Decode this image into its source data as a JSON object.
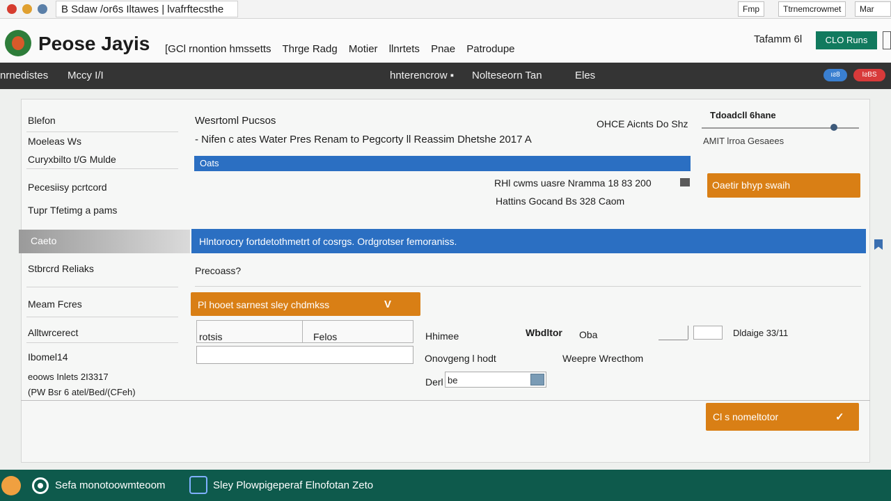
{
  "browser": {
    "tab_title": "B Sdaw /or6s Iltawes | lvafrftecsthe",
    "right_tab_1": "Fmp",
    "right_tab_2": "Ttrnemcrowmet",
    "right_tab_3": "Mar"
  },
  "header": {
    "logo_text": "Peose Jayis",
    "nav": [
      "[GCl rnontion hmssetts",
      "Thrge Radg",
      "Motier",
      "llnrtets",
      "Pnae",
      "Patrodupe"
    ],
    "user_text": "Tafamm 6l",
    "action_button": "CLO Runs"
  },
  "darknav": {
    "left_1": "nrnedistes",
    "left_2": "Mccy I/I",
    "center_1": "hnterencrow ▪",
    "center_2": "Nolteseorn Tan",
    "center_3": "Eles",
    "pill_blue": "ıƨ8",
    "pill_red": "IƨBS"
  },
  "sidebar": {
    "item_1": "Blefon",
    "item_2": "Moeleas Ws",
    "item_3": "Curyxbilto t/G Mulde",
    "item_4": "Pecesiisy pcrtcord",
    "item_5": "Tupr Tfetimg a pams",
    "section_header": "Caeto",
    "item_6": "Stbrcrd Reliaks",
    "item_7": "Meam Fcres",
    "item_8": "Alltwrcerect",
    "item_9": "Ibomel14",
    "item_10": "eoows Inlets 2I3317",
    "item_11": "(PW Bsr 6 atel/Bed/(CFeh)"
  },
  "main": {
    "title": "Wesrtoml Pucsos",
    "subtitle": "- Nifen c ates Water Pres Renam to Pegcorty ll Reassim Dhetshe 2017 A",
    "blue_bar_label": "Oats",
    "info_line_1": "RHl cwms uasre Nramma 18 83 200",
    "info_line_2": "Hattins Gocand Bs 328 Caom",
    "header_meta": "OHCE Aicnts Do Shz",
    "slider_label": "Tdoadcll 6hane",
    "slider_caption": "AMIT lrroa Gesaees",
    "orange_button_1": "Oaetir bhyp swaih",
    "banner_text": "Hlntorocry fortdetothmetrt of cosrgs. Ordgrotser femoraniss.",
    "price_label": "Precoass?",
    "dropdown_label": "Pl hooet sarnest sley chdmkss",
    "dropdown_chevron": "V",
    "col_1": "rotsis",
    "col_2": "Felos",
    "field_1_label": "Hhimee",
    "field_2_label": "Wbdltor",
    "field_3_label": "Oba",
    "field_4_label": "Dldaige 33/11",
    "field_5_label": "Onovgeng l hodt",
    "field_6_label": "Weepre Wrecthom",
    "field_7_label": "Derl",
    "field_7_value": "be",
    "orange_button_2": "Cl s nomeltotor",
    "orange_button_2_check": "✓"
  },
  "taskbar": {
    "item_1": "Sefa monotoowmteoom",
    "item_2": "Sley Plowpigeperaf Elnofotan Zeto"
  }
}
